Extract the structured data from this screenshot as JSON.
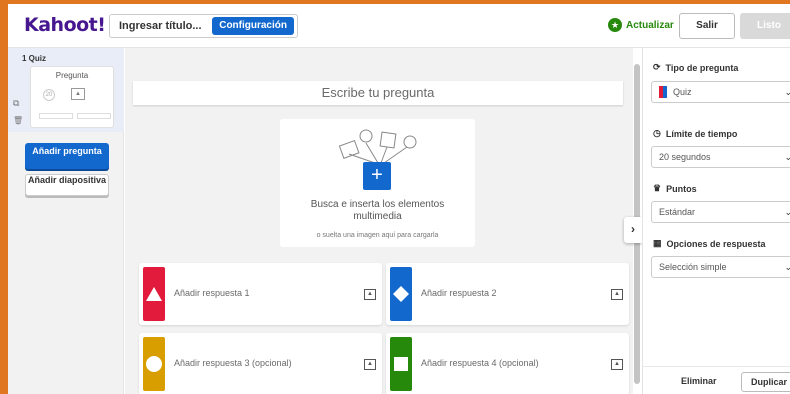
{
  "header": {
    "logo": "Kahoot!",
    "title_placeholder": "Ingresar título...",
    "config_label": "Configuración",
    "update_label": "Actualizar",
    "exit_label": "Salir",
    "done_label": "Listo"
  },
  "sidebar": {
    "slide_label": "1 Quiz",
    "slide_thumb_title": "Pregunta",
    "add_question_label": "Añadir pregunta",
    "add_slide_label": "Añadir diapositiva"
  },
  "editor": {
    "question_placeholder": "Escribe tu pregunta",
    "media_text": "Busca e inserta los elementos multimedia",
    "media_subtext": "o suelta una imagen aquí para cargarla",
    "answers": [
      {
        "label": "Añadir respuesta 1",
        "color": "#e21b3c",
        "shape": "triangle-icon"
      },
      {
        "label": "Añadir respuesta 2",
        "color": "#1368ce",
        "shape": "diamond-icon"
      },
      {
        "label": "Añadir respuesta 3 (opcional)",
        "color": "#d89e00",
        "shape": "circle-icon"
      },
      {
        "label": "Añadir respuesta 4 (opcional)",
        "color": "#26890c",
        "shape": "square-icon"
      }
    ]
  },
  "settings": {
    "question_type_title": "Tipo de pregunta",
    "question_type_value": "Quiz",
    "time_limit_title": "Límite de tiempo",
    "time_limit_value": "20 segundos",
    "points_title": "Puntos",
    "points_value": "Estándar",
    "answer_options_title": "Opciones de respuesta",
    "answer_options_value": "Selección simple",
    "delete_label": "Eliminar",
    "duplicate_label": "Duplicar"
  }
}
